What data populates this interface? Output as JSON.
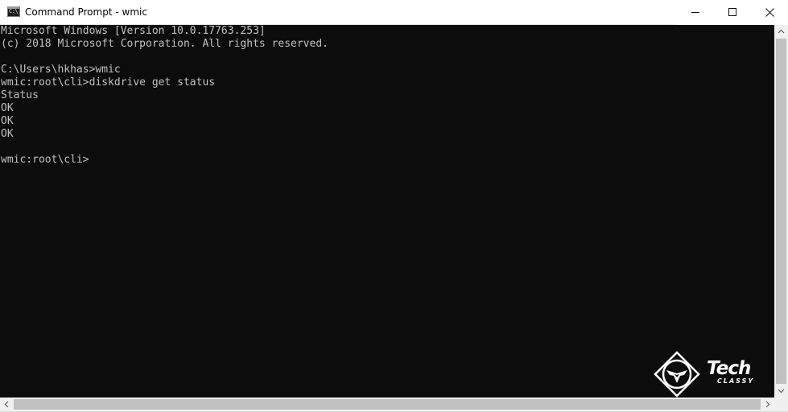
{
  "window": {
    "title": "Command Prompt - wmic",
    "icon": "command-prompt-icon",
    "icon_glyph": "C:\\_",
    "controls": {
      "minimize": "minimize-icon",
      "maximize": "maximize-icon",
      "close": "close-icon"
    }
  },
  "console": {
    "lines": [
      "Microsoft Windows [Version 10.0.17763.253]",
      "(c) 2018 Microsoft Corporation. All rights reserved.",
      "",
      "C:\\Users\\hkhas>wmic",
      "wmic:root\\cli>diskdrive get status",
      "Status",
      "OK",
      "OK",
      "OK",
      "",
      "wmic:root\\cli>"
    ]
  },
  "watermark": {
    "logo": "tech-classy-logo",
    "brand_line1": "Tech",
    "brand_line2": "CLASSY"
  },
  "colors": {
    "console_bg": "#0c0c0c",
    "console_text": "#c0c0c0",
    "titlebar_bg": "#ffffff",
    "scrollbar_bg": "#f0f0f0",
    "scrollbar_thumb": "#c1c1c1"
  }
}
